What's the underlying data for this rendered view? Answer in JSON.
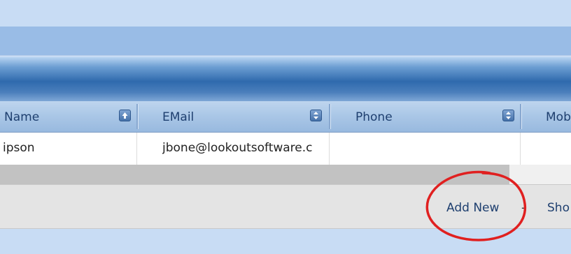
{
  "grid": {
    "columns": [
      {
        "label": "Name",
        "sort_icon": "sort-ascending-icon"
      },
      {
        "label": "EMail",
        "sort_icon": "sort-both-icon"
      },
      {
        "label": "Phone",
        "sort_icon": "sort-both-icon"
      },
      {
        "label": "Mob",
        "sort_icon": ""
      }
    ],
    "rows": [
      {
        "name": "ipson",
        "email": "jbone@lookoutsoftware.c",
        "phone": "",
        "mobile": ""
      }
    ]
  },
  "footer": {
    "add_new_label": "Add New",
    "separator": "-",
    "show_label": "Sho"
  },
  "annotation": {
    "shape": "circle",
    "color": "#e02020",
    "target": "add-new-link"
  },
  "colors": {
    "header_text": "#1e3f6f",
    "title_bar": "#2f6aad",
    "background": "#c8dcf4"
  }
}
